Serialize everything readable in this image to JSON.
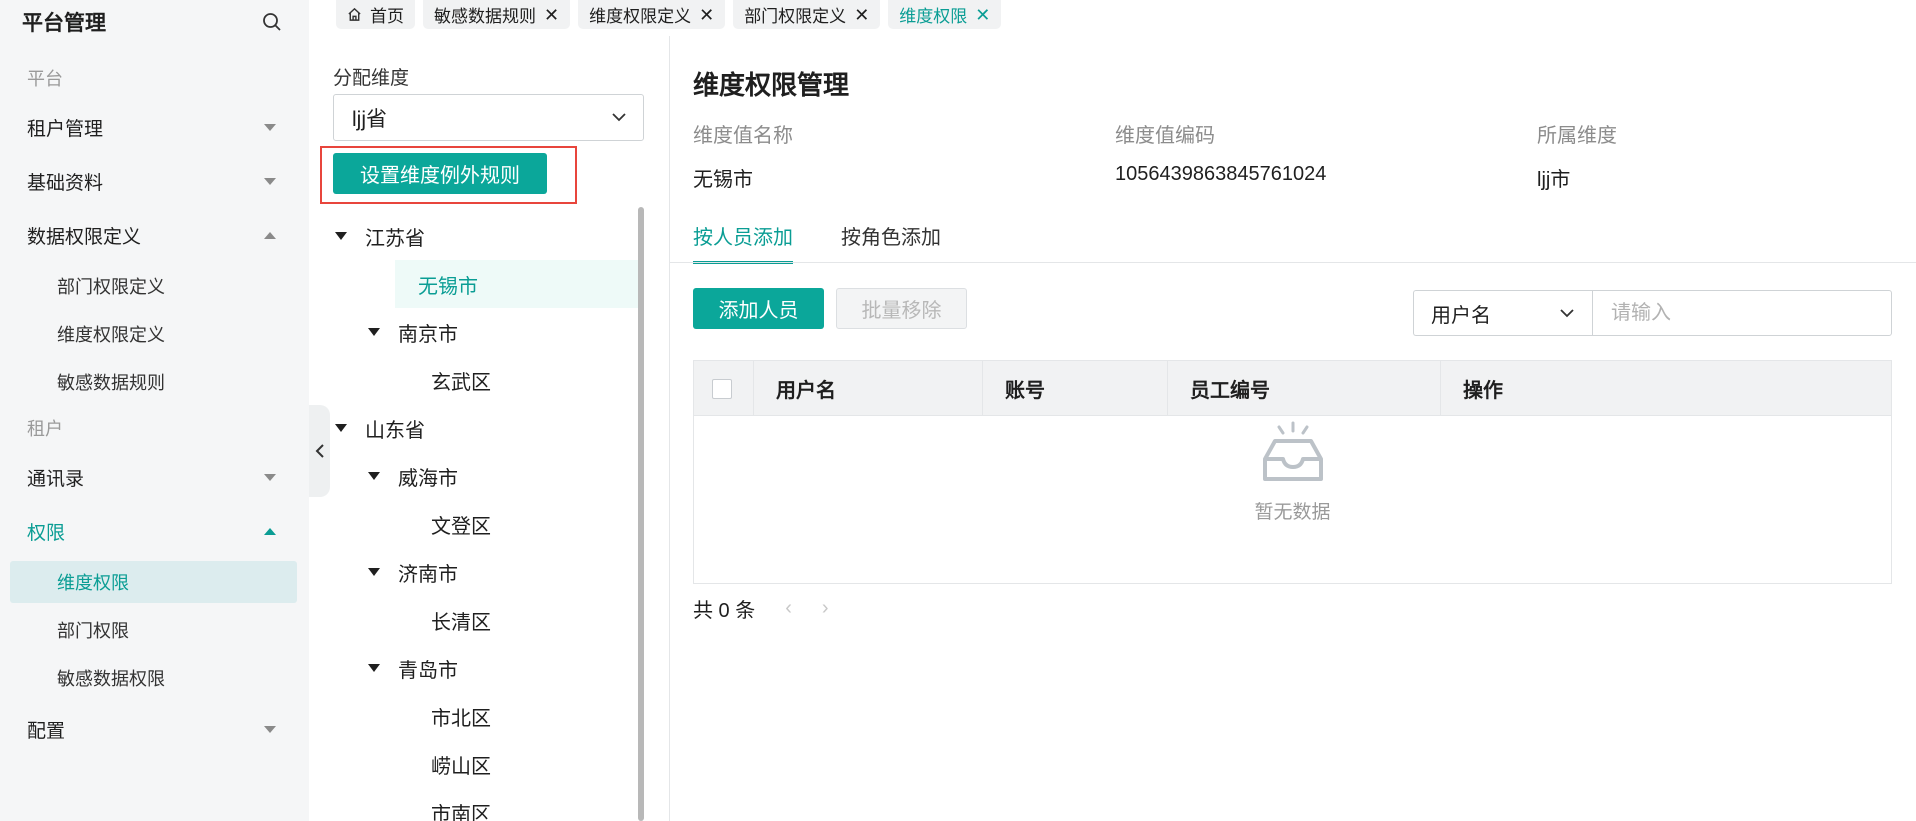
{
  "sidebar": {
    "title": "平台管理",
    "groups": [
      {
        "label": "平台"
      },
      {
        "label": "租户"
      }
    ],
    "items": [
      {
        "label": "租户管理"
      },
      {
        "label": "基础资料"
      },
      {
        "label": "数据权限定义"
      },
      {
        "label": "通讯录"
      },
      {
        "label": "权限"
      },
      {
        "label": "配置"
      }
    ],
    "sub_data": [
      "部门权限定义",
      "维度权限定义",
      "敏感数据规则"
    ],
    "sub_perm": [
      "维度权限",
      "部门权限",
      "敏感数据权限"
    ]
  },
  "tabs": [
    {
      "label": "首页"
    },
    {
      "label": "敏感数据规则"
    },
    {
      "label": "维度权限定义"
    },
    {
      "label": "部门权限定义"
    },
    {
      "label": "维度权限"
    }
  ],
  "middle": {
    "label": "分配维度",
    "select_value": "ljj省",
    "exception_button": "设置维度例外规则",
    "tree": [
      "江苏省",
      "无锡市",
      "南京市",
      "玄武区",
      "山东省",
      "威海市",
      "文登区",
      "济南市",
      "长清区",
      "青岛市",
      "市北区",
      "崂山区",
      "市南区"
    ]
  },
  "right": {
    "title": "维度权限管理",
    "info_labels": [
      "维度值名称",
      "维度值编码",
      "所属维度"
    ],
    "info_values": [
      "无锡市",
      "1056439863845761024",
      "ljj市"
    ],
    "tabs": [
      "按人员添加",
      "按角色添加"
    ],
    "add_button": "添加人员",
    "remove_button": "批量移除",
    "filter_select": "用户名",
    "filter_placeholder": "请输入",
    "columns": [
      "用户名",
      "账号",
      "员工编号",
      "操作"
    ],
    "empty_text": "暂无数据",
    "total": "共 0 条"
  },
  "colors": {
    "accent": "#0ba79a",
    "highlight_box": "#e8453c"
  }
}
